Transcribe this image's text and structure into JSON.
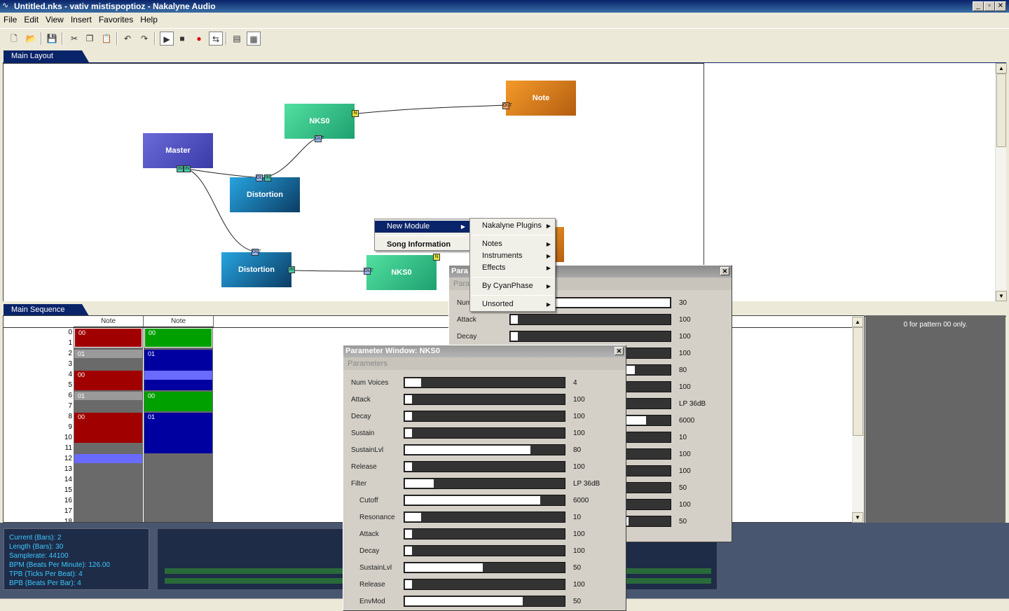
{
  "window": {
    "title": "Untitled.nks - vativ mistispoptioz - Nakalyne Audio",
    "controls": [
      "_",
      "▫",
      "✕"
    ]
  },
  "menubar": [
    "File",
    "Edit",
    "View",
    "Insert",
    "Favorites",
    "Help"
  ],
  "toolbar": [
    "new-file",
    "open",
    "save",
    "cut",
    "copy",
    "paste",
    "undo",
    "redo",
    "play",
    "stop",
    "record",
    "loop",
    "view-1",
    "view-2"
  ],
  "tabs": {
    "layout": "Main Layout",
    "sequence": "Main Sequence"
  },
  "modules": {
    "master": {
      "label": "Master",
      "color": "#5a5ad0"
    },
    "distortion1": {
      "label": "Distortion",
      "color": "#1f8ccc"
    },
    "distortion2": {
      "label": "Distortion",
      "color": "#1f8ccc"
    },
    "nks0_top": {
      "label": "NKS0",
      "color": "#3ed090"
    },
    "nks0_bottom": {
      "label": "NKS0",
      "color": "#3ed090"
    },
    "note": {
      "label": "Note",
      "color": "#e88820"
    }
  },
  "ports": {
    "in": "IN",
    "out": "OUT",
    "y": "N"
  },
  "context_menu": {
    "items": [
      "New Module",
      "Song Information"
    ],
    "submenu": [
      "Nakalyne Plugins",
      "Notes",
      "Instruments",
      "Effects",
      "By CyanPhase",
      "Unsorted"
    ]
  },
  "sequence": {
    "columns": [
      "Note",
      "Note"
    ],
    "rows": [
      "0",
      "1",
      "2",
      "3",
      "4",
      "5",
      "6",
      "7",
      "8",
      "9",
      "10",
      "11",
      "12",
      "13",
      "14",
      "15",
      "16",
      "17",
      "18"
    ],
    "col1_blocks": [
      "00",
      "01",
      "00",
      "01",
      "00"
    ],
    "col2_blocks": [
      "00",
      "01",
      "00",
      "01"
    ],
    "right_panel_text": "0 for pattern 00 only."
  },
  "info": {
    "current": "Current (Bars): 2",
    "length": "Length (Bars): 30",
    "samplerate": "Samplerate: 44100",
    "bpm": "BPM (Beats Per Minute): 126.00",
    "tpb": "TPB (Ticks Per Beat): 4",
    "bpb": "BPB (Beats Per Bar): 4"
  },
  "param_window_back": {
    "title": "Para",
    "subtitle": "Para",
    "rows": [
      {
        "label": "Num",
        "value": "30",
        "fill": 1.0
      },
      {
        "label": "Attack",
        "value": "100",
        "fill": 0.0
      },
      {
        "label": "Decay",
        "value": "100",
        "fill": 0.0
      },
      {
        "label": "",
        "value": "100",
        "fill": 0.0
      },
      {
        "label": "",
        "value": "80",
        "fill": 0.78
      },
      {
        "label": "",
        "value": "100",
        "fill": 0.0
      },
      {
        "label": "",
        "value": "LP 36dB",
        "fill": 0.18
      },
      {
        "label": "",
        "value": "6000",
        "fill": 0.85
      },
      {
        "label": "",
        "value": "10",
        "fill": 0.1
      },
      {
        "label": "",
        "value": "100",
        "fill": 0.0
      },
      {
        "label": "",
        "value": "100",
        "fill": 0.0
      },
      {
        "label": "",
        "value": "50",
        "fill": 0.49
      },
      {
        "label": "",
        "value": "100",
        "fill": 0.0
      },
      {
        "label": "",
        "value": "50",
        "fill": 0.74
      }
    ]
  },
  "param_window_front": {
    "title": "Parameter Window: NKS0",
    "subtitle": "Parameters",
    "rows": [
      {
        "label": "Num Voices",
        "value": "4",
        "fill": 0.1
      },
      {
        "label": "Attack",
        "value": "100",
        "fill": 0.0
      },
      {
        "label": "Decay",
        "value": "100",
        "fill": 0.0
      },
      {
        "label": "Sustain",
        "value": "100",
        "fill": 0.0
      },
      {
        "label": "SustainLvl",
        "value": "80",
        "fill": 0.79
      },
      {
        "label": "Release",
        "value": "100",
        "fill": 0.0
      },
      {
        "label": "Filter",
        "value": "LP 36dB",
        "fill": 0.18
      },
      {
        "label": "Cutoff",
        "value": "6000",
        "fill": 0.85
      },
      {
        "label": "Resonance",
        "value": "10",
        "fill": 0.1
      },
      {
        "label": "Attack",
        "value": "100",
        "fill": 0.0
      },
      {
        "label": "Decay",
        "value": "100",
        "fill": 0.0
      },
      {
        "label": "SustainLvl",
        "value": "50",
        "fill": 0.49
      },
      {
        "label": "Release",
        "value": "100",
        "fill": 0.0
      },
      {
        "label": "EnvMod",
        "value": "50",
        "fill": 0.74
      }
    ]
  }
}
